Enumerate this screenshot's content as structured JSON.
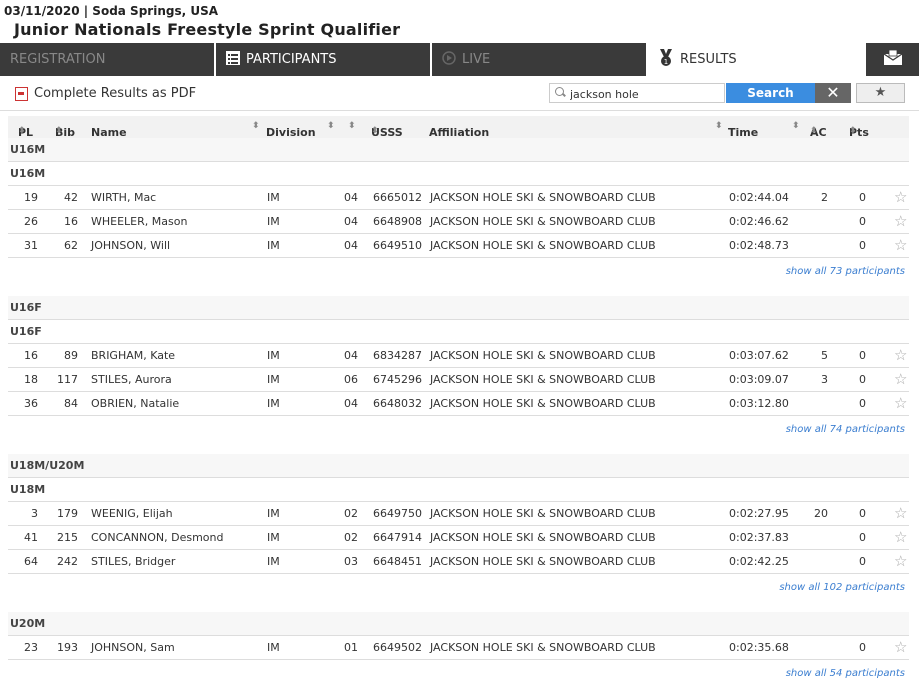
{
  "event": {
    "date_location": "03/11/2020 | Soda Springs, USA",
    "title": "Junior Nationals Freestyle Sprint Qualifier"
  },
  "nav": {
    "registration": "REGISTRATION",
    "participants": "PARTICIPANTS",
    "live": "LIVE",
    "results": "RESULTS"
  },
  "toolbar": {
    "pdf_label": "Complete Results as PDF",
    "search_value": "jackson hole",
    "search_label": "Search",
    "clear_label": "✕",
    "fav_label": "★"
  },
  "columns": {
    "pl": "PL",
    "bib": "Bib",
    "name": "Name",
    "division": "Division",
    "ussa": "USSS #",
    "affiliation": "Affiliation",
    "time": "Time",
    "ac": "AC",
    "pts": "Pts"
  },
  "groups": [
    {
      "name": "U16M",
      "sub": "U16M",
      "rows": [
        {
          "pl": "19",
          "bib": "42",
          "name": "WIRTH, Mac",
          "division": "IM",
          "yob": "04",
          "ussa": "6665012",
          "affiliation": "JACKSON HOLE SKI & SNOWBOARD CLUB",
          "time": "0:02:44.04",
          "ac": "2",
          "pts": "0"
        },
        {
          "pl": "26",
          "bib": "16",
          "name": "WHEELER, Mason",
          "division": "IM",
          "yob": "04",
          "ussa": "6648908",
          "affiliation": "JACKSON HOLE SKI & SNOWBOARD CLUB",
          "time": "0:02:46.62",
          "ac": "",
          "pts": "0"
        },
        {
          "pl": "31",
          "bib": "62",
          "name": "JOHNSON, Will",
          "division": "IM",
          "yob": "04",
          "ussa": "6649510",
          "affiliation": "JACKSON HOLE SKI & SNOWBOARD CLUB",
          "time": "0:02:48.73",
          "ac": "",
          "pts": "0"
        }
      ],
      "more": "show all 73 participants"
    },
    {
      "name": "U16F",
      "sub": "U16F",
      "rows": [
        {
          "pl": "16",
          "bib": "89",
          "name": "BRIGHAM, Kate",
          "division": "IM",
          "yob": "04",
          "ussa": "6834287",
          "affiliation": "JACKSON HOLE SKI & SNOWBOARD CLUB",
          "time": "0:03:07.62",
          "ac": "5",
          "pts": "0"
        },
        {
          "pl": "18",
          "bib": "117",
          "name": "STILES, Aurora",
          "division": "IM",
          "yob": "06",
          "ussa": "6745296",
          "affiliation": "JACKSON HOLE SKI & SNOWBOARD CLUB",
          "time": "0:03:09.07",
          "ac": "3",
          "pts": "0"
        },
        {
          "pl": "36",
          "bib": "84",
          "name": "OBRIEN, Natalie",
          "division": "IM",
          "yob": "04",
          "ussa": "6648032",
          "affiliation": "JACKSON HOLE SKI & SNOWBOARD CLUB",
          "time": "0:03:12.80",
          "ac": "",
          "pts": "0"
        }
      ],
      "more": "show all 74 participants"
    },
    {
      "name": "U18M/U20M",
      "sub": "U18M",
      "rows": [
        {
          "pl": "3",
          "bib": "179",
          "name": "WEENIG, Elijah",
          "division": "IM",
          "yob": "02",
          "ussa": "6649750",
          "affiliation": "JACKSON HOLE SKI & SNOWBOARD CLUB",
          "time": "0:02:27.95",
          "ac": "20",
          "pts": "0"
        },
        {
          "pl": "41",
          "bib": "215",
          "name": "CONCANNON, Desmond",
          "division": "IM",
          "yob": "02",
          "ussa": "6647914",
          "affiliation": "JACKSON HOLE SKI & SNOWBOARD CLUB",
          "time": "0:02:37.83",
          "ac": "",
          "pts": "0"
        },
        {
          "pl": "64",
          "bib": "242",
          "name": "STILES, Bridger",
          "division": "IM",
          "yob": "03",
          "ussa": "6648451",
          "affiliation": "JACKSON HOLE SKI & SNOWBOARD CLUB",
          "time": "0:02:42.25",
          "ac": "",
          "pts": "0"
        }
      ],
      "more": "show all 102 participants"
    },
    {
      "name": "U20M",
      "sub": "",
      "rows": [
        {
          "pl": "23",
          "bib": "193",
          "name": "JOHNSON, Sam",
          "division": "IM",
          "yob": "01",
          "ussa": "6649502",
          "affiliation": "JACKSON HOLE SKI & SNOWBOARD CLUB",
          "time": "0:02:35.68",
          "ac": "",
          "pts": "0"
        }
      ],
      "more": "show all 54 participants"
    }
  ]
}
